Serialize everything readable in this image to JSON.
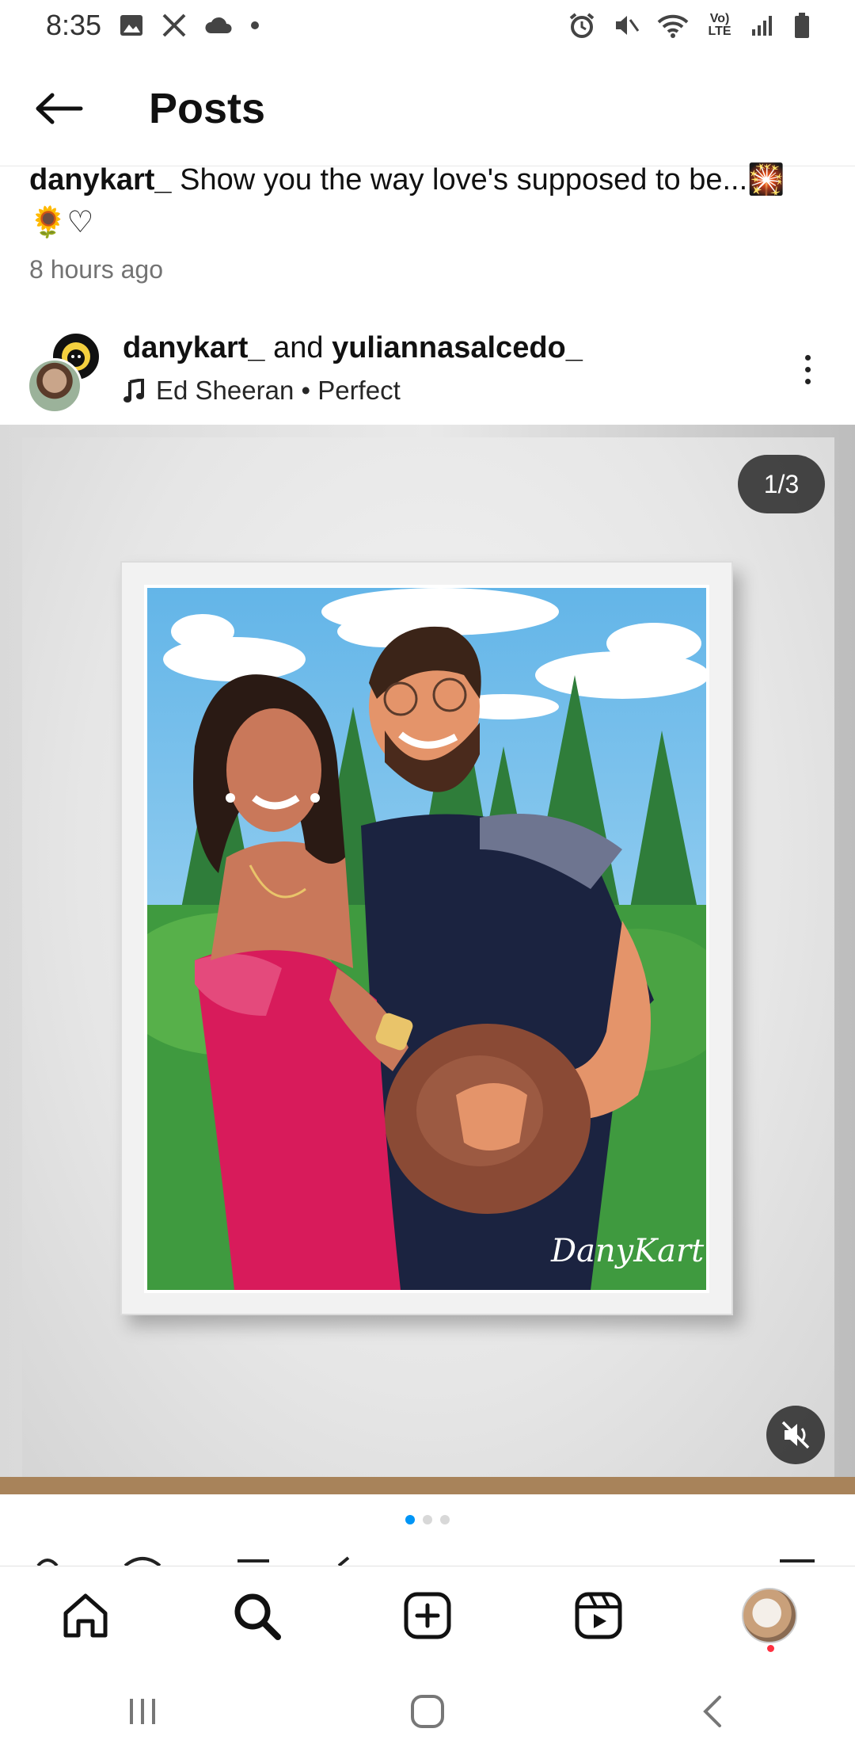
{
  "status_bar": {
    "time": "8:35",
    "network": "Vo) LTE",
    "icons_left": [
      "image-icon",
      "x-icon",
      "cloud-icon",
      "dot-icon"
    ],
    "icons_right": [
      "alarm-icon",
      "mute-vibrate-icon",
      "wifi-icon",
      "lte-icon",
      "signal-icon",
      "battery-icon"
    ]
  },
  "app_bar": {
    "title": "Posts",
    "back_icon": "arrow-left-icon"
  },
  "caption": {
    "username": "danykart_",
    "text": " Show you the way love's supposed to be...🎇",
    "text_line2": "🌻♡",
    "time_ago": "8 hours ago"
  },
  "post_header": {
    "user1": "danykart_",
    "and": " and ",
    "user2": "yuliannasalcedo_",
    "audio_artist": "Ed Sheeran",
    "separator": " • ",
    "audio_title": "Perfect"
  },
  "media": {
    "counter": "1/3",
    "watermark": "DanyKart"
  },
  "carousel": {
    "total": 3,
    "active": 0
  },
  "bottom_nav": {
    "items": [
      "home-icon",
      "search-icon",
      "create-icon",
      "reels-icon",
      "profile-avatar"
    ]
  },
  "colors": {
    "accent": "#0095f6",
    "notification": "#ff3040",
    "dress": "#d81b5b",
    "shirt": "#1b2340",
    "sky": "#7cc4ea"
  }
}
